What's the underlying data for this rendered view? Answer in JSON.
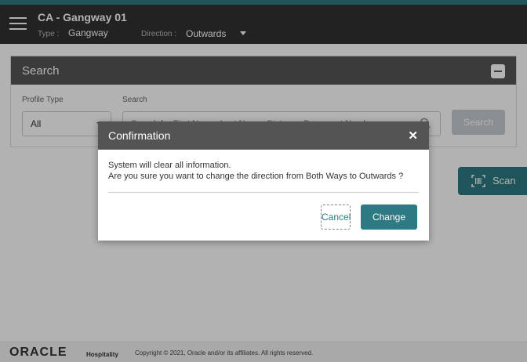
{
  "header": {
    "title": "CA - Gangway 01",
    "type_label": "Type :",
    "type_value": "Gangway",
    "direction_label": "Direction :",
    "direction_value": "Outwards"
  },
  "search_panel": {
    "title": "Search",
    "profile_type_label": "Profile Type",
    "profile_type_value": "All",
    "search_label": "Search",
    "search_placeholder": "Search for First Name, Last Name, Status or Document Number",
    "search_button": "Search"
  },
  "scan": {
    "label": "Scan"
  },
  "dialog": {
    "title": "Confirmation",
    "close": "✕",
    "message_line1": "System will clear all information.",
    "message_line2": "Are you sure you want to change the direction from Both Ways to Outwards ?",
    "cancel_label": "Cancel",
    "change_label": "Change"
  },
  "footer": {
    "brand": "ORACLE",
    "product": "Hospitality",
    "copyright": "Copyright © 2021, Oracle and/or its affiliates. All rights reserved."
  },
  "colors": {
    "accent": "#2d7a82",
    "header_bg": "#313131",
    "panel_head_bg": "#555555"
  },
  "icons": [
    "menu-icon",
    "chevron-down-icon",
    "collapse-icon",
    "search-icon",
    "barcode-scan-icon",
    "close-icon"
  ]
}
